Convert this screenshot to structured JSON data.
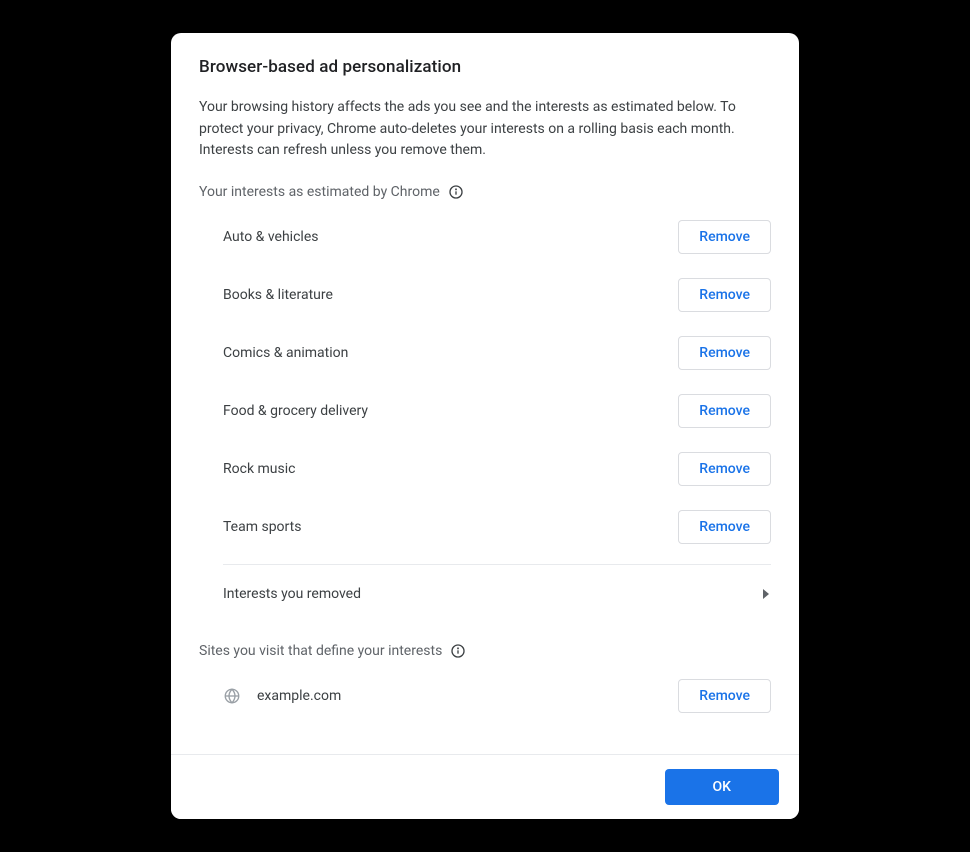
{
  "dialog": {
    "title": "Browser-based ad personalization",
    "description": "Your browsing history affects the ads you see and the interests as estimated below. To protect your privacy, Chrome auto-deletes your interests on a rolling basis each month. Interests can refresh unless you remove them.",
    "interests_label": "Your interests as estimated by Chrome",
    "remove_label": "Remove",
    "interests": [
      "Auto & vehicles",
      "Books & literature",
      "Comics & animation",
      "Food & grocery delivery",
      "Rock music",
      "Team sports"
    ],
    "removed_label": "Interests you removed",
    "sites_label": "Sites you visit that define your interests",
    "sites": [
      "example.com"
    ],
    "ok_label": "OK"
  }
}
